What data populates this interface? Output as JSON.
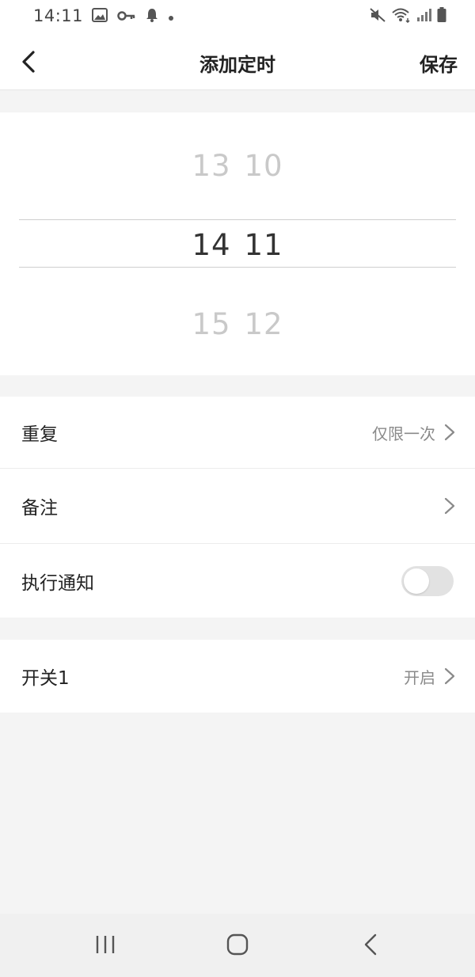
{
  "status_bar": {
    "time": "14:11",
    "icons": [
      "image-icon",
      "key-icon",
      "bell-icon",
      "dot-icon",
      "mute-icon",
      "wifi-icon",
      "signal-icon",
      "battery-icon"
    ]
  },
  "header": {
    "title": "添加定时",
    "save_label": "保存",
    "back_icon": "chevron-left-icon"
  },
  "time_picker": {
    "hours": [
      "13",
      "14",
      "15"
    ],
    "minutes": [
      "10",
      "11",
      "12"
    ],
    "selected_hour": "14",
    "selected_minute": "11"
  },
  "settings": {
    "repeat": {
      "label": "重复",
      "value": "仅限一次"
    },
    "note": {
      "label": "备注",
      "value": ""
    },
    "notify": {
      "label": "执行通知",
      "enabled": false
    }
  },
  "switch_item": {
    "label": "开关1",
    "value": "开启"
  },
  "colors": {
    "background": "#f4f4f4",
    "card": "#ffffff",
    "text": "#222222",
    "secondary_text": "#8a8a8a",
    "picker_dim": "#c9c9c9",
    "toggle_off": "#e2e2e2"
  },
  "nav_bar": {
    "icons": [
      "recents-icon",
      "home-icon",
      "back-icon"
    ]
  }
}
